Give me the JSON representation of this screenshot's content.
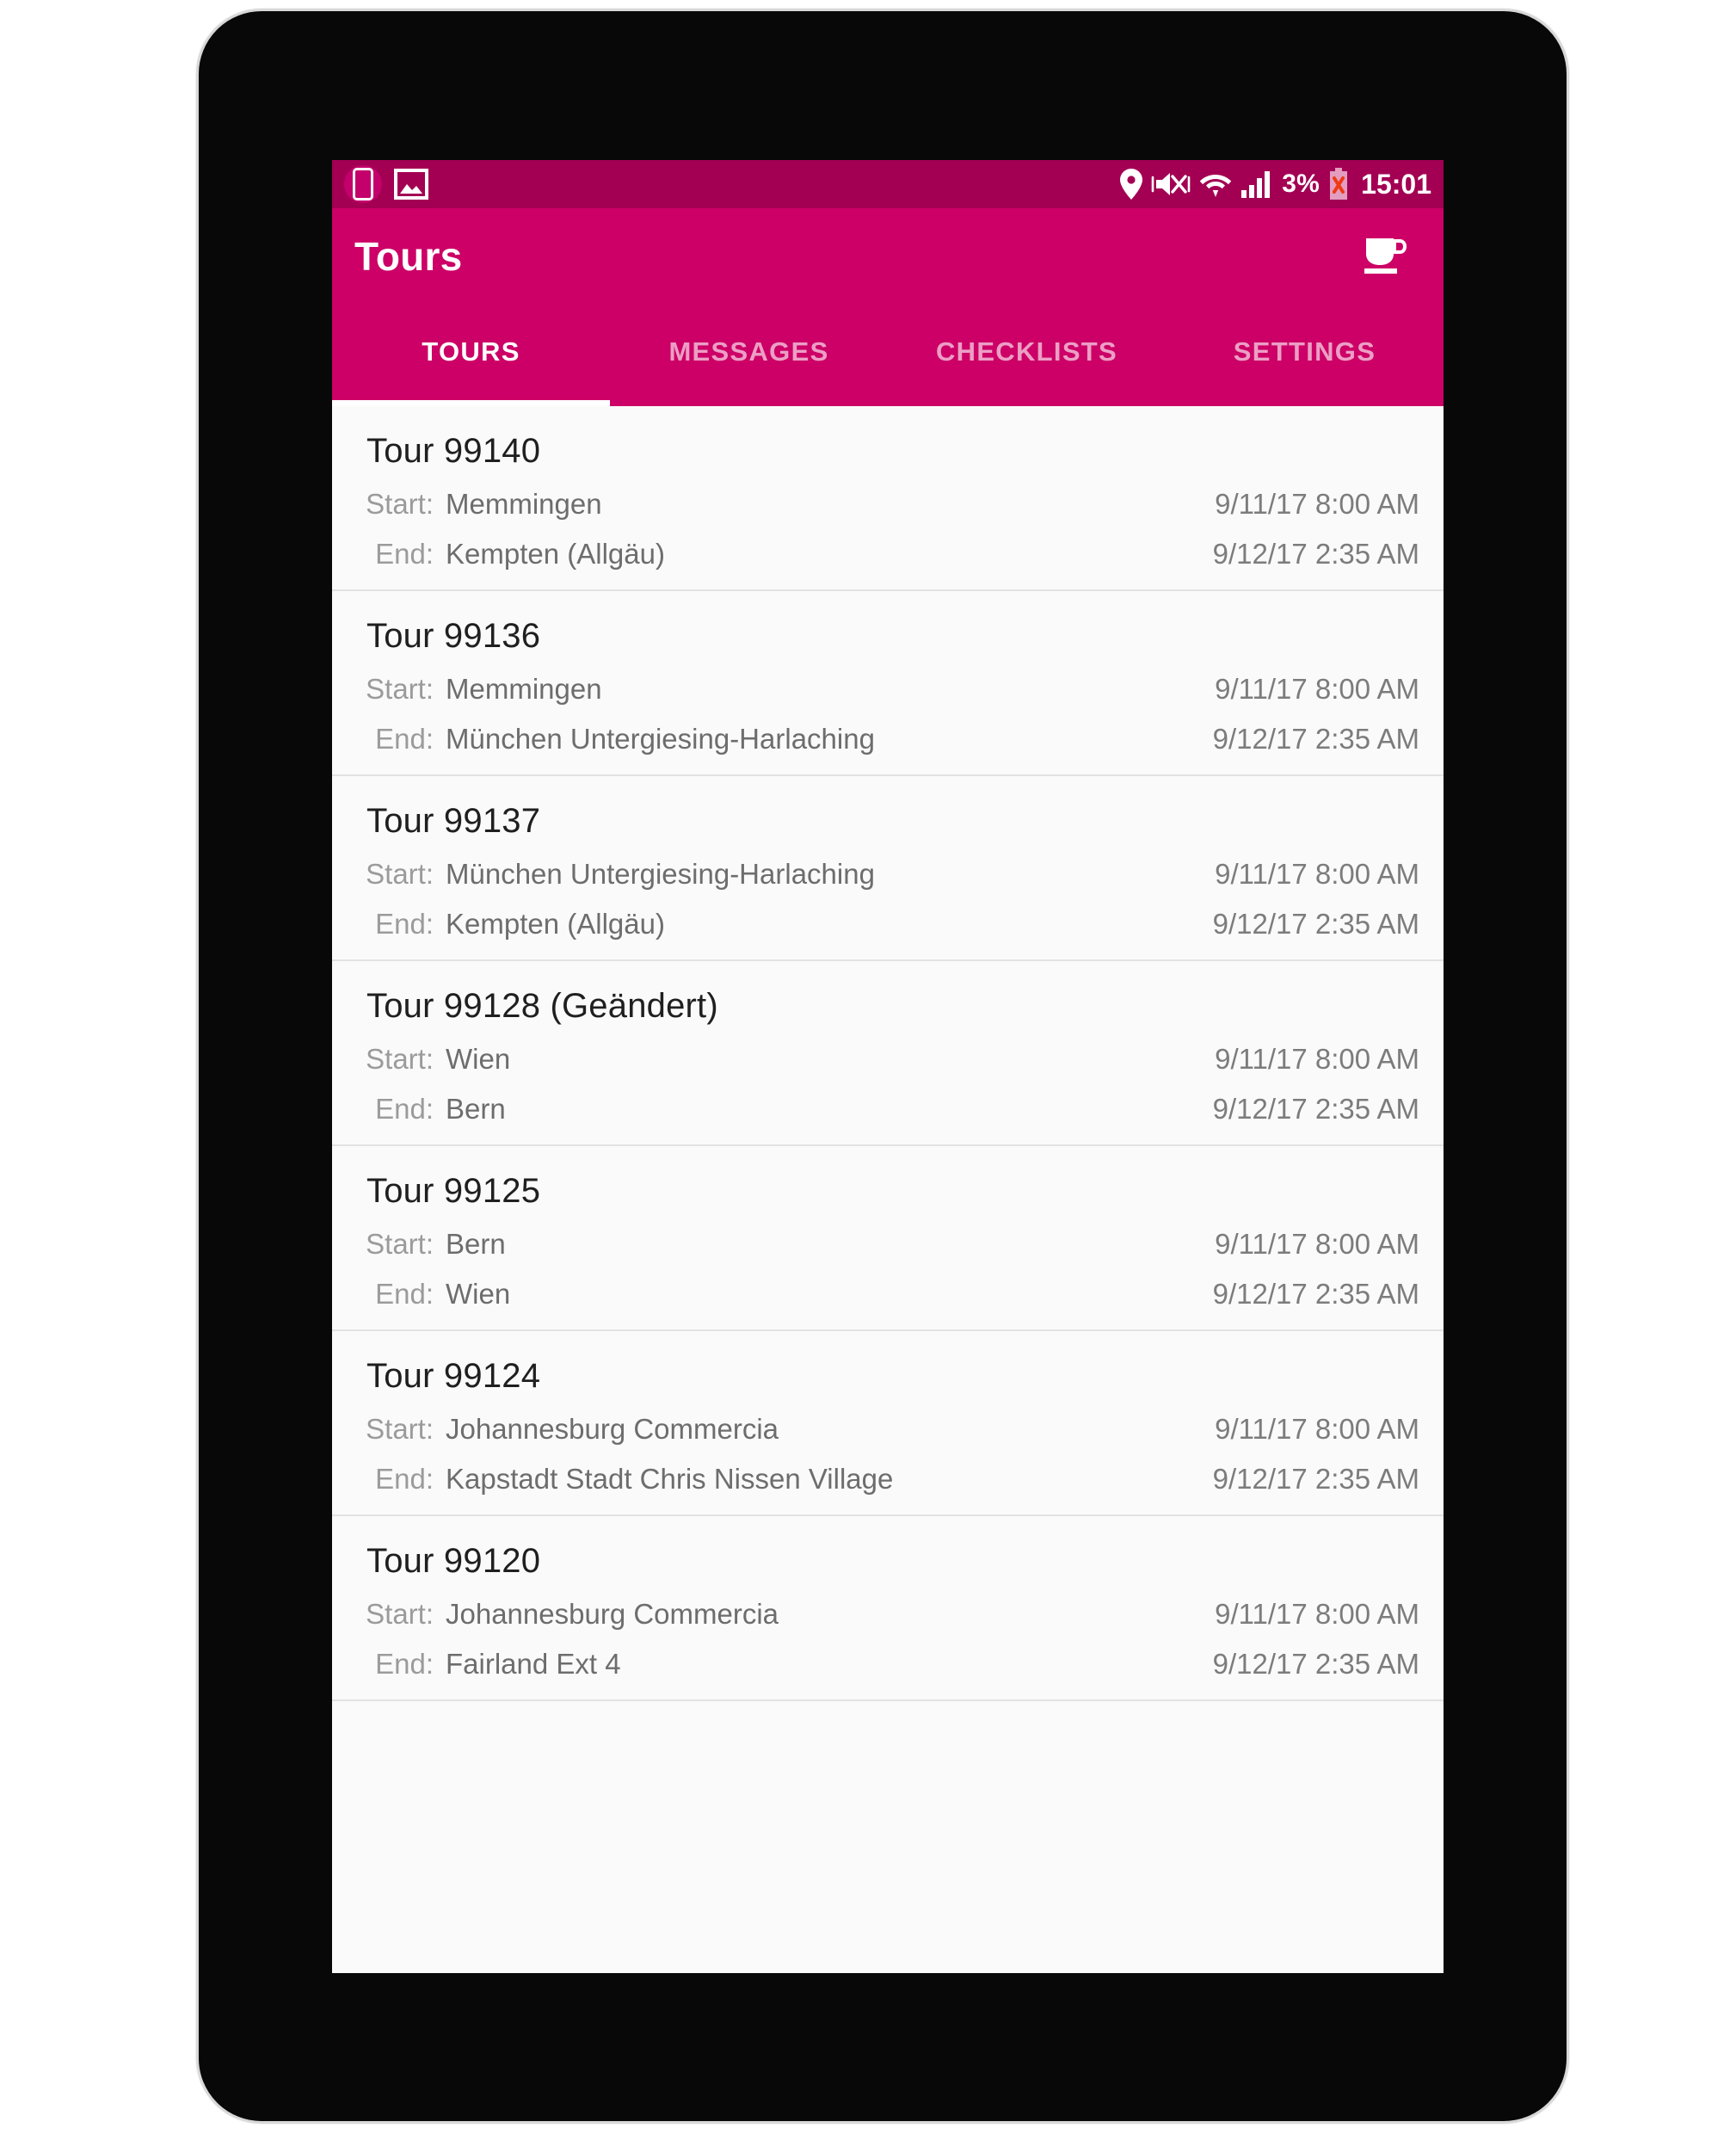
{
  "status_bar": {
    "icons_left": [
      "sim-card-icon",
      "screenshot-image-icon"
    ],
    "icons_right": [
      "location-pin-icon",
      "mute-vibrate-icon",
      "wifi-icon",
      "signal-bars-icon"
    ],
    "battery_percent": "3%",
    "battery_icon": "battery-alert-icon",
    "clock": "15:01",
    "background": "#a30053"
  },
  "app_bar": {
    "title": "Tours",
    "action_icon": "coffee-cup-icon",
    "background": "#cc0066"
  },
  "tabs": {
    "active_index": 0,
    "items": [
      {
        "label": "TOURS"
      },
      {
        "label": "MESSAGES"
      },
      {
        "label": "CHECKLISTS"
      },
      {
        "label": "SETTINGS"
      }
    ]
  },
  "list": {
    "start_label": "Start:",
    "end_label": "End:",
    "tours": [
      {
        "title": "Tour 99140",
        "start_place": "Memmingen",
        "start_time": "9/11/17 8:00 AM",
        "end_place": "Kempten (Allgäu)",
        "end_time": "9/12/17 2:35 AM"
      },
      {
        "title": "Tour 99136",
        "start_place": "Memmingen",
        "start_time": "9/11/17 8:00 AM",
        "end_place": "München Untergiesing-Harlaching",
        "end_time": "9/12/17 2:35 AM"
      },
      {
        "title": "Tour 99137",
        "start_place": "München Untergiesing-Harlaching",
        "start_time": "9/11/17 8:00 AM",
        "end_place": "Kempten (Allgäu)",
        "end_time": "9/12/17 2:35 AM"
      },
      {
        "title": "Tour 99128 (Geändert)",
        "start_place": "Wien",
        "start_time": "9/11/17 8:00 AM",
        "end_place": "Bern",
        "end_time": "9/12/17 2:35 AM"
      },
      {
        "title": "Tour 99125",
        "start_place": "Bern",
        "start_time": "9/11/17 8:00 AM",
        "end_place": "Wien",
        "end_time": "9/12/17 2:35 AM"
      },
      {
        "title": "Tour 99124",
        "start_place": "Johannesburg Commercia",
        "start_time": "9/11/17 8:00 AM",
        "end_place": "Kapstadt Stadt Chris Nissen Village",
        "end_time": "9/12/17 2:35 AM"
      },
      {
        "title": "Tour 99120",
        "start_place": "Johannesburg Commercia",
        "start_time": "9/11/17 8:00 AM",
        "end_place": "Fairland Ext 4",
        "end_time": "9/12/17 2:35 AM"
      }
    ]
  }
}
